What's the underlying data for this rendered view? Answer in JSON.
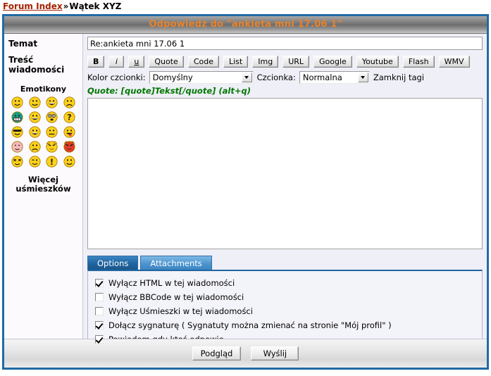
{
  "breadcrumb": {
    "link_text": "Forum Index",
    "separator": "»",
    "current": "Wątek XYZ"
  },
  "panel": {
    "title": "Odpowiedz do \"ankieta mni 17.06 1\""
  },
  "form": {
    "subject_label": "Temat",
    "subject_value": "Re:ankieta mni 17.06 1",
    "message_label_line1": "Treść",
    "message_label_line2": "wiadomości",
    "message_value": "",
    "message_placeholder": ""
  },
  "bbcode_buttons": [
    {
      "label": "B",
      "style": "bold",
      "name": "bbcode-bold-button"
    },
    {
      "label": "i",
      "style": "italic",
      "name": "bbcode-italic-button"
    },
    {
      "label": "u",
      "style": "underline",
      "name": "bbcode-underline-button"
    },
    {
      "label": "Quote",
      "style": "normal",
      "name": "bbcode-quote-button"
    },
    {
      "label": "Code",
      "style": "normal",
      "name": "bbcode-code-button"
    },
    {
      "label": "List",
      "style": "normal",
      "name": "bbcode-list-button"
    },
    {
      "label": "Img",
      "style": "normal",
      "name": "bbcode-img-button"
    },
    {
      "label": "URL",
      "style": "normal",
      "name": "bbcode-url-button"
    },
    {
      "label": "Google",
      "style": "normal",
      "name": "bbcode-google-button"
    },
    {
      "label": "Youtube",
      "style": "normal",
      "name": "bbcode-youtube-button"
    },
    {
      "label": "Flash",
      "style": "normal",
      "name": "bbcode-flash-button"
    },
    {
      "label": "WMV",
      "style": "normal",
      "name": "bbcode-wmv-button"
    }
  ],
  "controls": {
    "font_color_label": "Kolor czcionki:",
    "font_color_value": "Domyślny",
    "font_size_label": "Czcionka:",
    "font_size_value": "Normalna",
    "close_tags_label": "Zamknij tagi"
  },
  "hint": {
    "text": "Quote: [quote]Tekst[/quote]  (alt+q)",
    "color": "#007700"
  },
  "emoticons": {
    "title": "Emotikony",
    "more_label_line1": "Więcej",
    "more_label_line2": "uśmieszków",
    "items": [
      {
        "name": "smiley-smile-icon",
        "face": "#FFD11A",
        "type": "smile"
      },
      {
        "name": "smiley-smile2-icon",
        "face": "#FFD11A",
        "type": "smile"
      },
      {
        "name": "smiley-biggrin-icon",
        "face": "#FFD11A",
        "type": "biggrin"
      },
      {
        "name": "smiley-sad-icon",
        "face": "#FFD11A",
        "type": "sad"
      },
      {
        "name": "smiley-cool-teeth-icon",
        "face": "#15A08A",
        "type": "teeth"
      },
      {
        "name": "smiley-grin-icon",
        "face": "#FFD11A",
        "type": "grin"
      },
      {
        "name": "smiley-eek-icon",
        "face": "#FFD11A",
        "type": "eek"
      },
      {
        "name": "smiley-question-icon",
        "face": "#FFD11A",
        "type": "question"
      },
      {
        "name": "smiley-sunglasses-icon",
        "face": "#FFD11A",
        "type": "sunglasses"
      },
      {
        "name": "smiley-laugh-icon",
        "face": "#FFD11A",
        "type": "laugh"
      },
      {
        "name": "smiley-neutral-icon",
        "face": "#FFD11A",
        "type": "neutral"
      },
      {
        "name": "smiley-tongue-icon",
        "face": "#FFD11A",
        "type": "tongue"
      },
      {
        "name": "smiley-blush-icon",
        "face": "#F7B9BE",
        "type": "blush"
      },
      {
        "name": "smiley-frown-icon",
        "face": "#FFD11A",
        "type": "frown"
      },
      {
        "name": "smiley-evil-icon",
        "face": "#FFD11A",
        "type": "evil"
      },
      {
        "name": "smiley-evil-red-icon",
        "face": "#E03A2A",
        "type": "evil"
      },
      {
        "name": "smiley-dizzy-icon",
        "face": "#FFD11A",
        "type": "dizzy"
      },
      {
        "name": "smiley-wink-icon",
        "face": "#FFD11A",
        "type": "wink"
      },
      {
        "name": "smiley-exclaim-icon",
        "face": "#FFD11A",
        "type": "exclaim"
      },
      {
        "name": "smiley-smile3-icon",
        "face": "#FFD11A",
        "type": "smile"
      }
    ]
  },
  "tabs": [
    {
      "label": "Options",
      "active": true,
      "name": "tab-options"
    },
    {
      "label": "Attachments",
      "active": false,
      "name": "tab-attachments"
    }
  ],
  "options": [
    {
      "label": "Wyłącz HTML w tej wiadomości",
      "checked": true,
      "name": "option-disable-html"
    },
    {
      "label": "Wyłącz BBCode w tej wiadomości",
      "checked": false,
      "name": "option-disable-bbcode"
    },
    {
      "label": "Wyłącz Uśmieszki w tej wiadomości",
      "checked": false,
      "name": "option-disable-smilies"
    },
    {
      "label": "Dołącz sygnaturę ( Sygnatuty można zmienać na stronie \"Mój profil\" )",
      "checked": true,
      "name": "option-attach-signature"
    },
    {
      "label": "Powiadom gdy ktoś odpowie",
      "checked": true,
      "name": "option-notify-reply"
    }
  ],
  "footer": {
    "preview_label": "Podgląd",
    "submit_label": "Wyślij"
  },
  "colors": {
    "frame_border": "#1F6BA4",
    "title_text": "#E8832B",
    "link": "#A62200",
    "tab_active": "#2166A0",
    "panel_bg": "#EFEFF7"
  }
}
